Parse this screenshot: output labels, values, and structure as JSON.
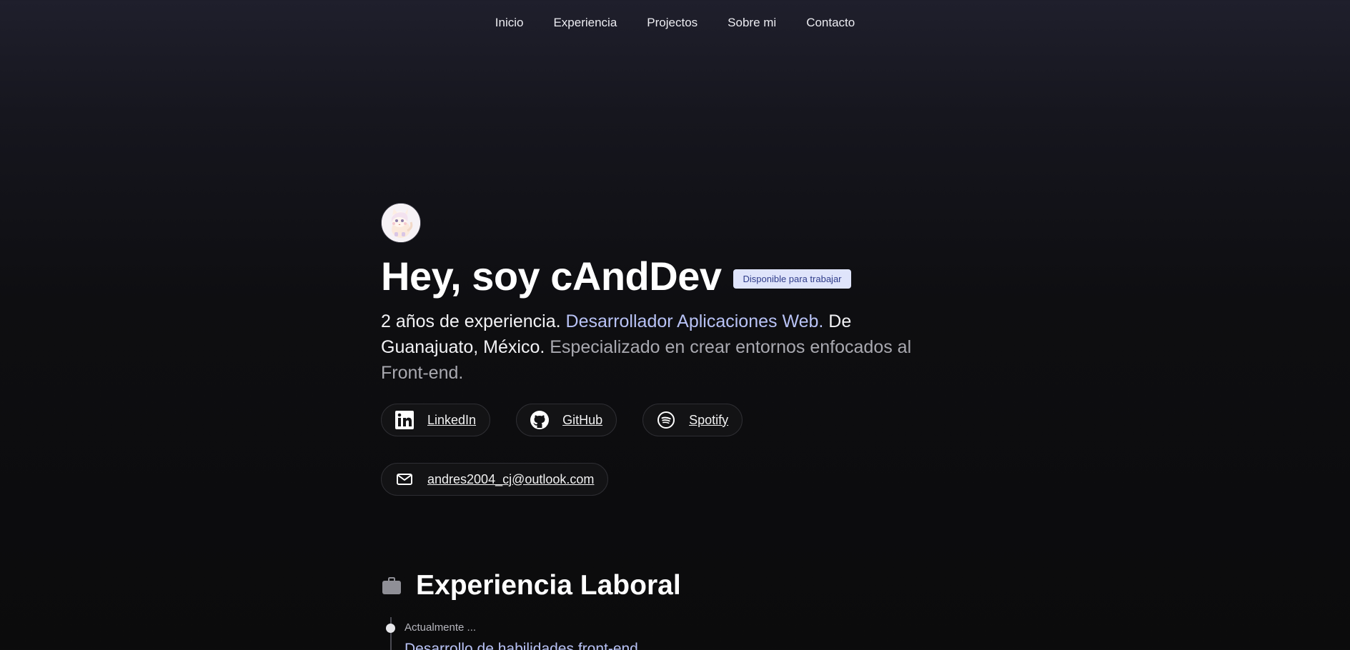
{
  "nav": {
    "items": [
      {
        "label": "Inicio"
      },
      {
        "label": "Experiencia"
      },
      {
        "label": "Projectos"
      },
      {
        "label": "Sobre mi"
      },
      {
        "label": "Contacto"
      }
    ]
  },
  "hero": {
    "title": "Hey, soy cAndDev",
    "badge": "Disponible para trabajar",
    "intro": {
      "part1": "2 años de experiencia. ",
      "part2": "Desarrollador Aplicaciones Web.",
      "part3": " De Guanajuato, México. ",
      "part4": "Especializado en crear entornos enfocados al Front-end."
    },
    "socials": [
      {
        "label": "LinkedIn",
        "icon": "linkedin-icon"
      },
      {
        "label": "GitHub",
        "icon": "github-icon"
      },
      {
        "label": "Spotify",
        "icon": "spotify-icon"
      }
    ],
    "email": {
      "label": "andres2004_cj@outlook.com",
      "icon": "mail-icon"
    }
  },
  "experience": {
    "heading": "Experiencia Laboral",
    "icon": "briefcase-icon",
    "items": [
      {
        "date": "Actualmente ...",
        "title": "Desarrollo de habilidades front-end"
      }
    ]
  },
  "colors": {
    "accent": "#b8c2f5",
    "badge_bg": "#dfe4fb",
    "badge_text": "#2f3c8a"
  }
}
